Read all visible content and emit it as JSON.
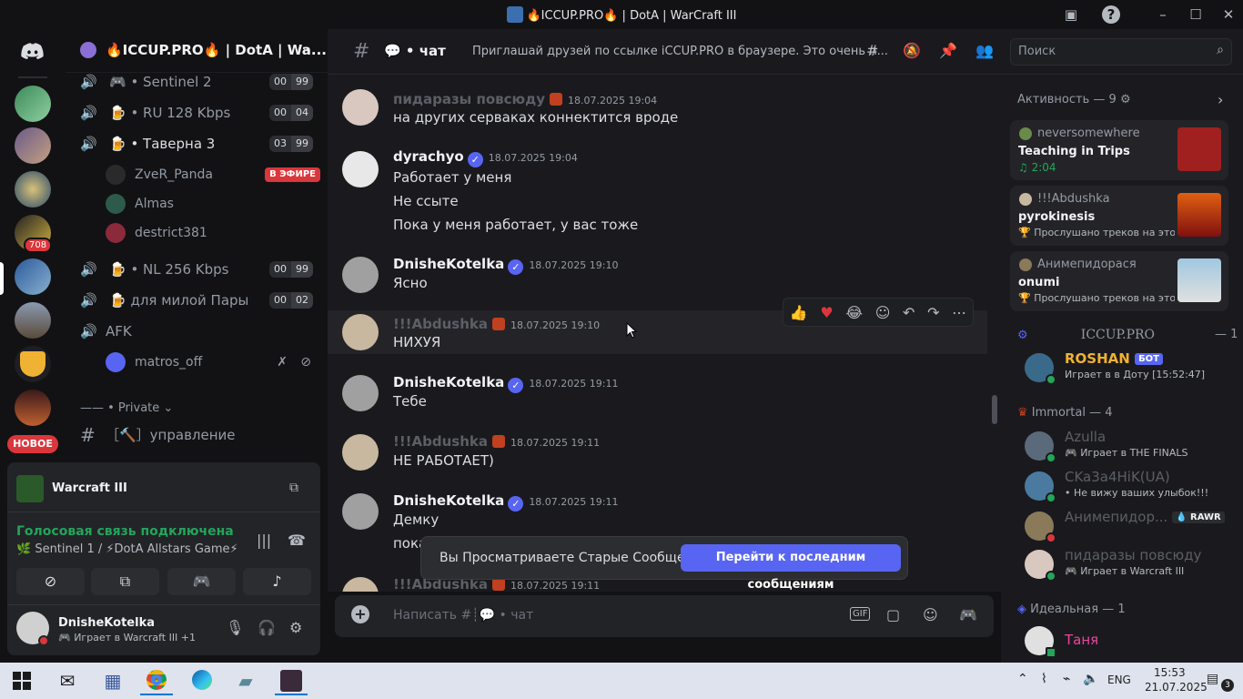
{
  "window": {
    "title": "🔥ICCUP.PRO🔥 | DotA | WarCraft III"
  },
  "servers": {
    "mention_count": "708",
    "new_label": "НОВОЕ"
  },
  "sidebar": {
    "guild_name": "🔥ICCUP.PRO🔥 | DotA | Wa...",
    "voice_channels": [
      {
        "name": "🎮 • Sentinel 2",
        "users": "00",
        "limit": "99"
      },
      {
        "name": "🍺 • RU 128 Kbps",
        "users": "00",
        "limit": "04"
      },
      {
        "name": "🍺 • Таверна 3",
        "users": "03",
        "limit": "99"
      },
      {
        "name": "🍺 • NL 256 Kbps",
        "users": "00",
        "limit": "99"
      },
      {
        "name": "🍺 для милой Пары",
        "users": "00",
        "limit": "02"
      },
      {
        "name": "AFK"
      }
    ],
    "tavern_users": [
      {
        "name": "ZveR_Panda",
        "live": "В ЭФИРЕ"
      },
      {
        "name": "Almas"
      },
      {
        "name": "destrict381"
      }
    ],
    "afk_user": "matros_off",
    "category": "—— • Private",
    "text_channel": "［🔨］управление"
  },
  "panel": {
    "activity": "Warcraft III",
    "voice_status": "Голосовая связь подключена",
    "voice_channel": "🌿 Sentinel 1 / ⚡DotA Allstars Game⚡",
    "username": "DnisheKotelka",
    "user_status": "🎮 Играет в Warcraft III +1"
  },
  "chat": {
    "channel": "💬 • чат",
    "topic": "Приглашай друзей по ссылке iCCUP.PRO в браузере. Это очень п...",
    "search_placeholder": "Поиск",
    "input_placeholder": "Написать #┊💬 • чат",
    "jump_notice": "Вы Просматриваете Старые Сообщения",
    "jump_button": "Перейти к последним сообщениям",
    "messages": [
      {
        "author": "пидаразы повсюду",
        "ts": "18.07.2025 19:04",
        "lines": [
          "на других серваках коннектится вроде"
        ]
      },
      {
        "author": "dyrachyo",
        "ts": "18.07.2025 19:04",
        "lines": [
          "Работает у меня",
          "Не ссыте",
          "Пока у меня работает, у вас тоже"
        ]
      },
      {
        "author": "DnisheKotelka",
        "ts": "18.07.2025 19:10",
        "lines": [
          "Ясно"
        ]
      },
      {
        "author": "!!!Abdushka",
        "ts": "18.07.2025 19:10",
        "lines": [
          "НИХУЯ"
        ]
      },
      {
        "author": "DnisheKotelka",
        "ts": "18.07.2025 19:11",
        "lines": [
          "Тебе"
        ]
      },
      {
        "author": "!!!Abdushka",
        "ts": "18.07.2025 19:11",
        "lines": [
          "НЕ РАБОТАЕТ)"
        ]
      },
      {
        "author": "DnisheKotelka",
        "ts": "18.07.2025 19:11",
        "lines": [
          "Демку",
          "пока"
        ]
      },
      {
        "author": "!!!Abdushka",
        "ts": "18.07.2025 19:11",
        "lines": []
      }
    ]
  },
  "members": {
    "activity_header": "Активность — 9",
    "activities": [
      {
        "user": "neversomewhere",
        "title": "Teaching in Trips",
        "sub": "♫ 2:04"
      },
      {
        "user": "!!!Abdushka",
        "title": "pyrokinesis",
        "sub": "🏆 Прослушано треков на этой..."
      },
      {
        "user": "Анимепидорася",
        "title": "onumi",
        "sub": "🏆 Прослушано треков на этой..."
      }
    ],
    "groups": [
      {
        "name": "ICCUP.PRO",
        "count": "— 1"
      },
      {
        "name": "Immortal — 4"
      },
      {
        "name": "Идеальная — 1"
      }
    ],
    "list": [
      {
        "name": "ROSHAN",
        "tag": "БОТ",
        "sub": "Играет в в Доту [15:52:47]"
      },
      {
        "name": "Azulla",
        "sub": "🎮 Играет в THE FINALS"
      },
      {
        "name": "CKa3a4HiK(UA)",
        "sub": "• Не вижу ваших улыбок!!!"
      },
      {
        "name": "Анимепидор...",
        "tag": "💧 RAWR"
      },
      {
        "name": "пидаразы повсюду",
        "sub": "🎮 Играет в Warcraft III"
      },
      {
        "name": "Таня"
      }
    ]
  },
  "taskbar": {
    "lang": "ENG",
    "time": "15:53",
    "date": "21.07.2025",
    "notif": "3"
  },
  "colors": {
    "accent": "#5865f2",
    "live": "#da373c",
    "green": "#23a55a",
    "gold": "#f0b232"
  }
}
